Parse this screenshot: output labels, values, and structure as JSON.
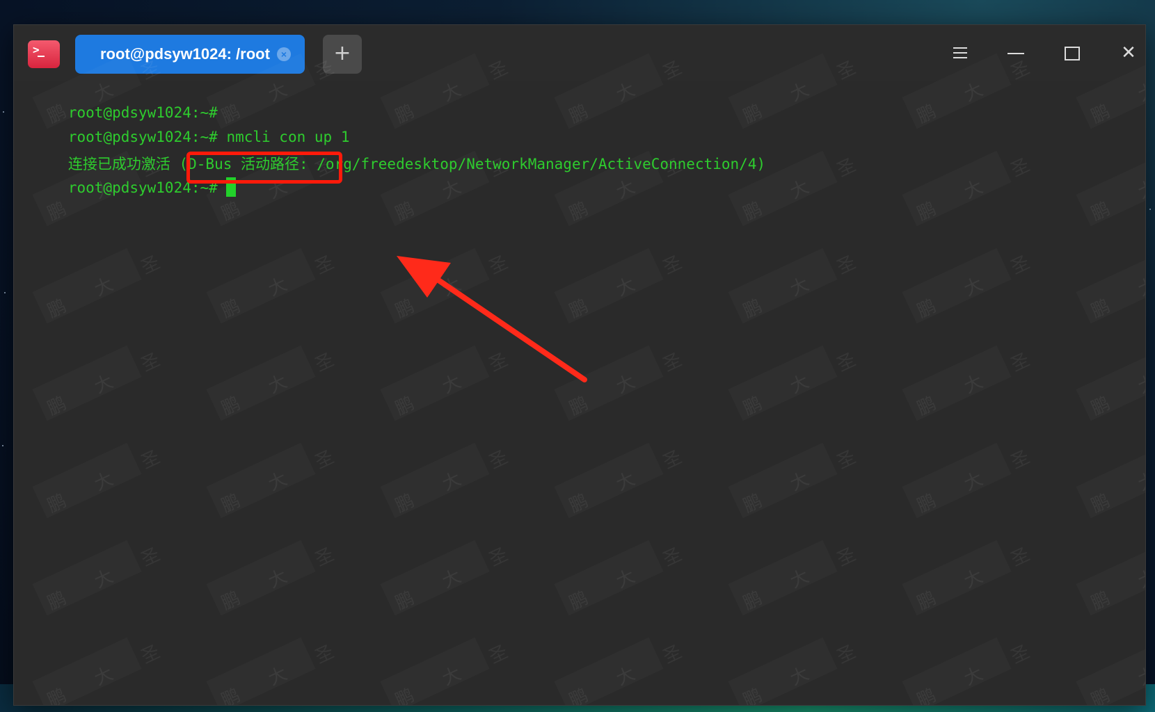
{
  "window": {
    "tab_title": "root@pdsyw1024: /root",
    "tab_close_glyph": "×",
    "new_tab_glyph": "+",
    "menu_icon": "menu-icon",
    "minimize_icon": "minimize-icon",
    "maximize_icon": "maximize-icon",
    "close_glyph": "✕"
  },
  "terminal": {
    "lines": [
      {
        "prompt": "root@pdsyw1024:~#",
        "command": ""
      },
      {
        "prompt": "root@pdsyw1024:~#",
        "command": "nmcli con up 1"
      },
      {
        "output": "连接已成功激活 (D-Bus 活动路径: /org/freedesktop/NetworkManager/ActiveConnection/4)"
      },
      {
        "prompt": "root@pdsyw1024:~#",
        "command": ""
      }
    ]
  },
  "annotations": {
    "highlight_color": "#ff1a0a",
    "arrow_color": "#ff2a1a"
  },
  "watermark_text": "鹏 大 圣",
  "colors": {
    "terminal_bg": "#2a2a2a",
    "terminal_fg": "#2ecc2e",
    "tab_active": "#1e7ae0"
  }
}
